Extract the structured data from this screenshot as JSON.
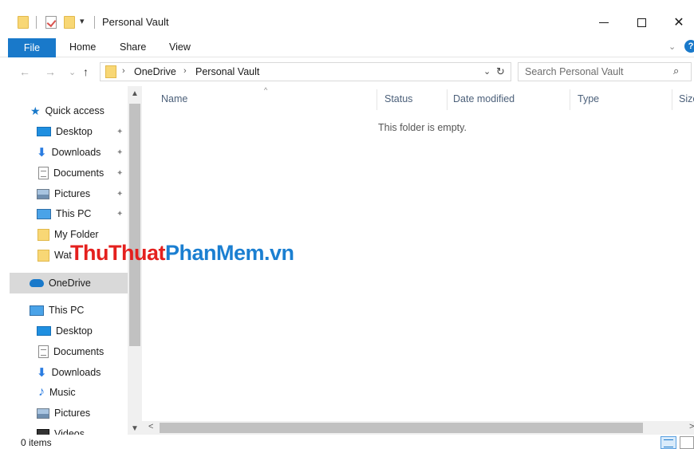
{
  "window": {
    "title": "Personal Vault",
    "quick_access_dropdown": "▾",
    "minimize": "—",
    "close": "✕"
  },
  "ribbon": {
    "tabs": [
      {
        "label": "File"
      },
      {
        "label": "Home"
      },
      {
        "label": "Share"
      },
      {
        "label": "View"
      }
    ],
    "expand": "⌄",
    "help": "?"
  },
  "address": {
    "back": "←",
    "forward": "→",
    "recent": "⌄",
    "up": "↑",
    "breadcrumbs": [
      "OneDrive",
      "Personal Vault"
    ],
    "separator": "›",
    "dropdown": "⌄",
    "refresh": "↻",
    "search_placeholder": "Search Personal Vault",
    "search_glyph": "⌕"
  },
  "nav_pane": {
    "quick_access": "Quick access",
    "pin": "📌",
    "quick_items": [
      {
        "label": "Desktop",
        "icon": "desktop-icon"
      },
      {
        "label": "Downloads",
        "icon": "download-icon"
      },
      {
        "label": "Documents",
        "icon": "documents-icon"
      },
      {
        "label": "Pictures",
        "icon": "pictures-icon"
      },
      {
        "label": "This PC",
        "icon": "computer-icon"
      },
      {
        "label": "My Folder",
        "icon": "folder-icon"
      },
      {
        "label": "Wat",
        "icon": "folder-icon"
      }
    ],
    "onedrive": "OneDrive",
    "this_pc": "This PC",
    "pc_items": [
      {
        "label": "Desktop",
        "icon": "desktop-icon"
      },
      {
        "label": "Documents",
        "icon": "documents-icon"
      },
      {
        "label": "Downloads",
        "icon": "download-icon"
      },
      {
        "label": "Music",
        "icon": "music-icon"
      },
      {
        "label": "Pictures",
        "icon": "pictures-icon"
      },
      {
        "label": "Videos",
        "icon": "videos-icon"
      }
    ],
    "scroll_up": "▲",
    "scroll_down": "▼"
  },
  "content": {
    "columns": [
      "Name",
      "Status",
      "Date modified",
      "Type",
      "Size"
    ],
    "sort_glyph": "^",
    "empty_message": "This folder is empty."
  },
  "hscroll": {
    "left": "<",
    "right": ">"
  },
  "status": {
    "item_count": "0 items"
  },
  "watermark": {
    "part1": "ThuThuat",
    "part2": "PhanMem.vn"
  }
}
